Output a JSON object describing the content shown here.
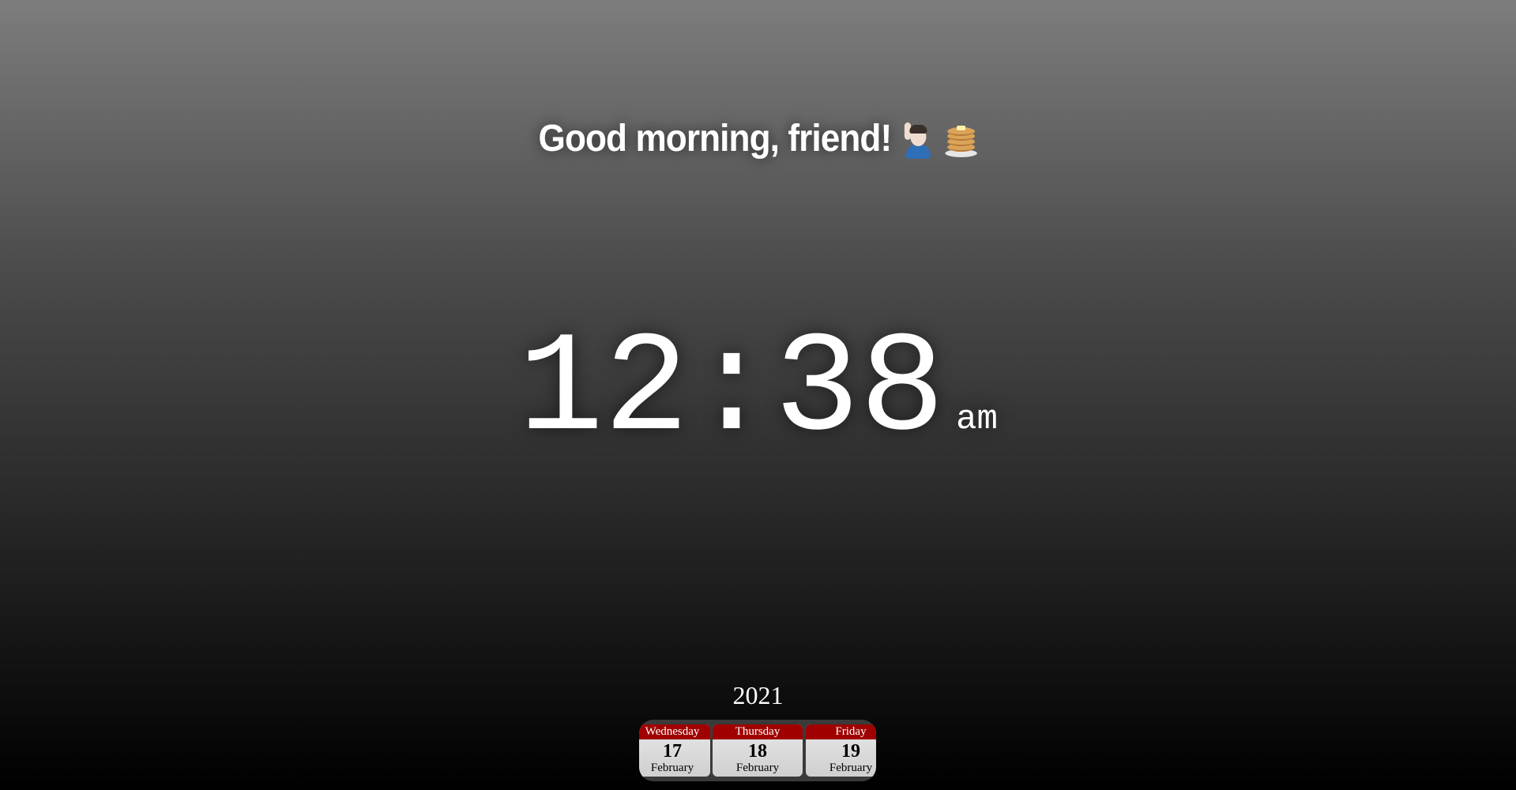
{
  "greeting": {
    "text": "Good morning, friend!",
    "emoji": [
      "person-raising-hand-icon",
      "pancakes-icon"
    ]
  },
  "clock": {
    "time": "12:38",
    "period": "am"
  },
  "calendar": {
    "year": "2021",
    "days": [
      {
        "weekday": "Wednesday",
        "day": "17",
        "month": "February"
      },
      {
        "weekday": "Thursday",
        "day": "18",
        "month": "February"
      },
      {
        "weekday": "Friday",
        "day": "19",
        "month": "February"
      }
    ]
  },
  "colors": {
    "weekday_header": "#a00000",
    "text": "#ffffff"
  }
}
